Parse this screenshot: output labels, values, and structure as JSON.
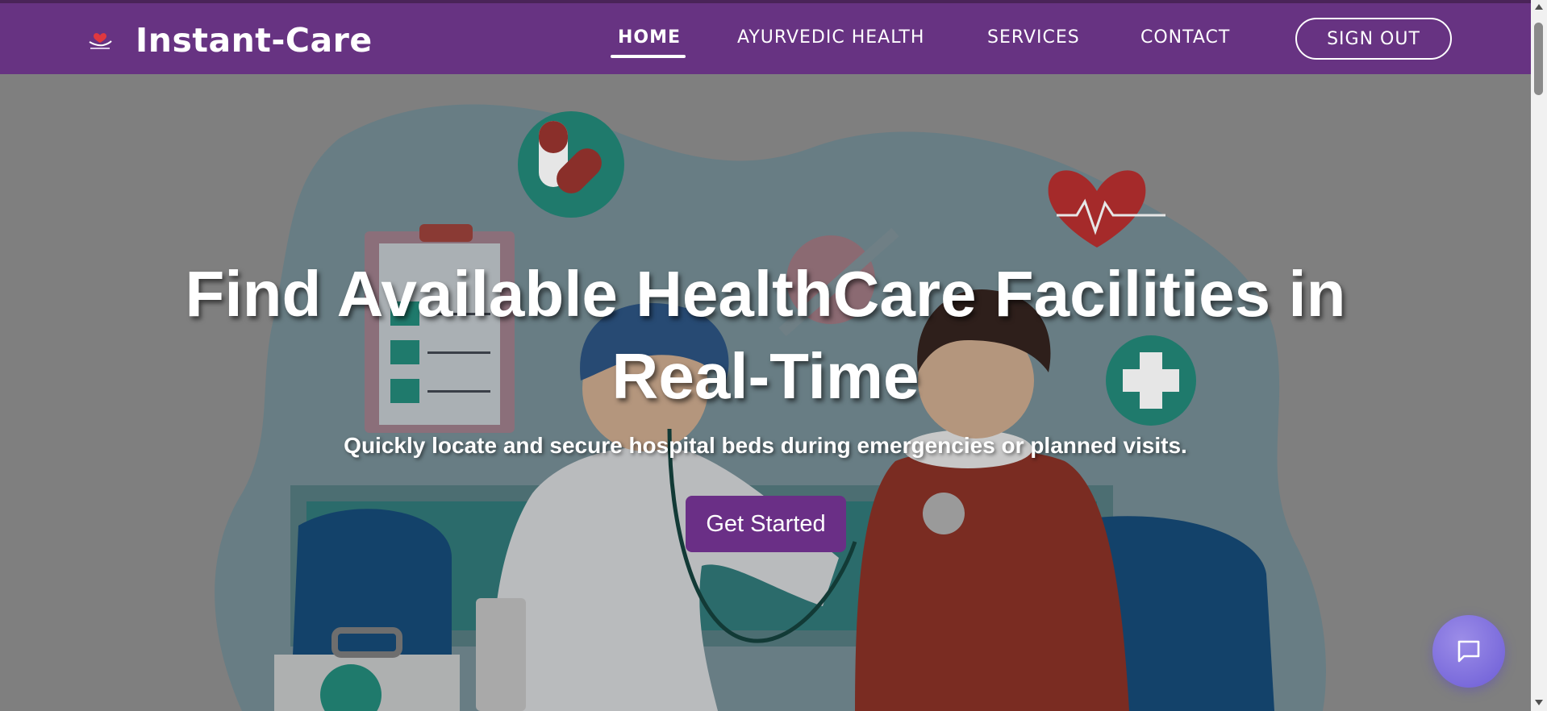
{
  "brand": {
    "name": "Instant-Care",
    "logo_icon": "heart-hand-logo-icon"
  },
  "nav": {
    "links": [
      {
        "label": "HOME",
        "active": true
      },
      {
        "label": "AYURVEDIC HEALTH",
        "active": false
      },
      {
        "label": "SERVICES",
        "active": false
      },
      {
        "label": "CONTACT",
        "active": false
      }
    ],
    "signout_label": "SIGN OUT"
  },
  "hero": {
    "title_line1": "Find Available HealthCare Facilities in",
    "title_line2": "Real-Time",
    "subtitle": "Quickly locate and secure hospital beds during emergencies or planned visits.",
    "cta_label": "Get Started"
  },
  "chat": {
    "icon": "chat-bubble-icon"
  },
  "colors": {
    "navbar": "#673382",
    "cta": "#6a2f86",
    "chat_button": "#7b6ce0"
  }
}
